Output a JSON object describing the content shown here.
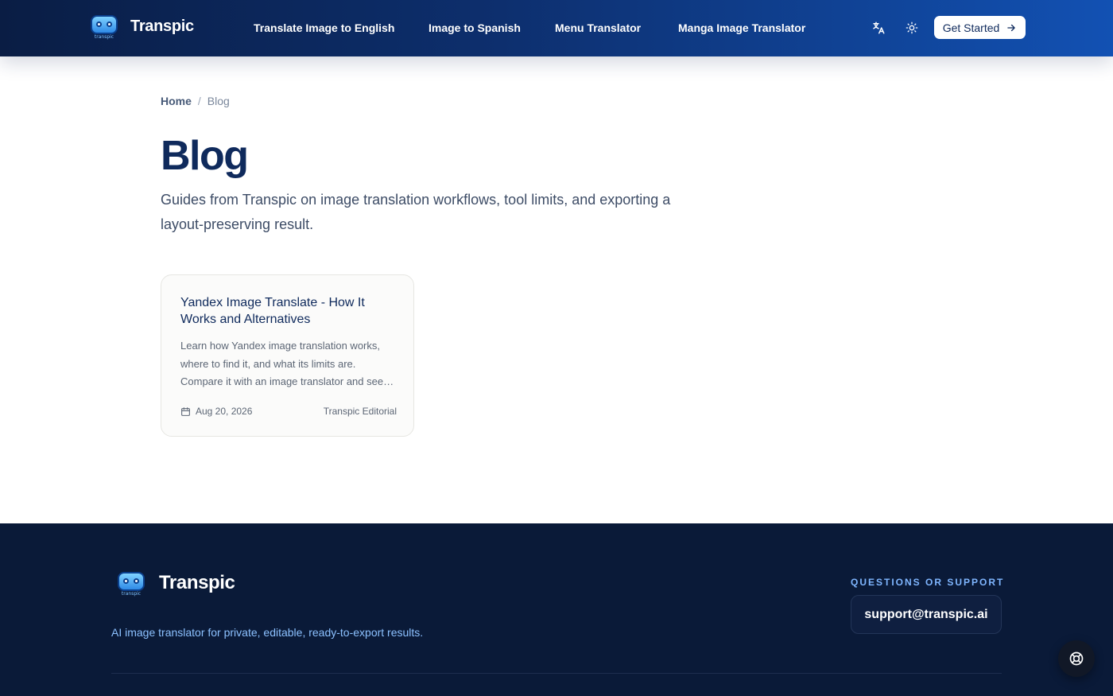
{
  "header": {
    "brand": "Transpic",
    "logo_tag": "transpic",
    "nav": [
      {
        "label": "Translate Image to English"
      },
      {
        "label": "Image to Spanish"
      },
      {
        "label": "Menu Translator"
      },
      {
        "label": "Manga Image Translator"
      }
    ],
    "icons": [
      "translate-icon",
      "sun-icon"
    ],
    "cta_label": "Get Started"
  },
  "breadcrumb": {
    "home": "Home",
    "separator": "/",
    "current": "Blog"
  },
  "page": {
    "title": "Blog",
    "description": "Guides from Transpic on image translation workflows, tool limits, and exporting a layout-preserving result."
  },
  "posts": [
    {
      "title": "Yandex Image Translate - How It Works and Alternatives",
      "excerpt": "Learn how Yandex image translation works, where to find it, and what its limits are. Compare it with an image translator and see when layout preservation matters.",
      "date": "Aug 20, 2026",
      "author": "Transpic Editorial"
    }
  ],
  "footer": {
    "brand": "Transpic",
    "logo_tag": "transpic",
    "tagline": "AI image translator for private, editable, ready-to-export results.",
    "support_label": "QUESTIONS OR SUPPORT",
    "support_email": "support@transpic.ai"
  },
  "colors": {
    "header_start": "#0a1d44",
    "header_end": "#1251b3",
    "title": "#0f2a5c",
    "footer_bg": "#0a1a38",
    "footer_accent": "#7fb6ff"
  }
}
